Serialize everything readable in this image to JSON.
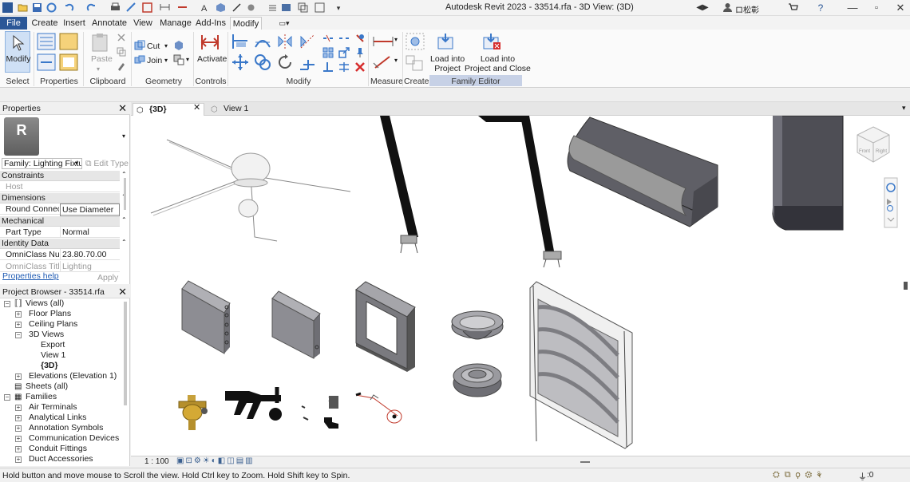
{
  "title": "Autodesk Revit 2023 - 33514.rfa - 3D View: (3D)",
  "user": "ロ松彰",
  "menu": [
    "File",
    "Create",
    "Insert",
    "Annotate",
    "View",
    "Manage",
    "Add-Ins",
    "Modify"
  ],
  "ribbon": {
    "modify_label": "Modify",
    "paste_label": "Paste",
    "cut_label": "Cut",
    "join_label": "Join",
    "activate_label": "Activate",
    "load_into_project": "Load into\nProject",
    "load_into_project_close": "Load into\nProject and Close",
    "panels": {
      "select": "Select",
      "properties": "Properties",
      "clipboard": "Clipboard",
      "geometry": "Geometry",
      "controls": "Controls",
      "modify": "Modify",
      "measure": "Measure",
      "create": "Create",
      "family_editor": "Family Editor"
    }
  },
  "properties": {
    "header": "Properties",
    "family_selector": "Family: Lighting Fixtur",
    "edit_type": "Edit Type",
    "groups": {
      "constraints": "Constraints",
      "dimensions": "Dimensions",
      "mechanical": "Mechanical",
      "identity": "Identity Data"
    },
    "rows": {
      "host": {
        "k": "Host",
        "v": ""
      },
      "round": {
        "k": "Round Connect...",
        "v": "Use Diameter"
      },
      "part": {
        "k": "Part Type",
        "v": "Normal"
      },
      "omni_num": {
        "k": "OmniClass Nu...",
        "v": "23.80.70.00"
      },
      "omni_title": {
        "k": "OmniClass Title",
        "v": "Lighting"
      }
    },
    "help_link": "Properties help",
    "apply": "Apply"
  },
  "browser": {
    "header": "Project Browser - 33514.rfa",
    "items": {
      "views": "Views (all)",
      "floor": "Floor Plans",
      "ceiling": "Ceiling Plans",
      "views3d": "3D Views",
      "export": "Export",
      "view1": "View 1",
      "v3d": "{3D}",
      "elev": "Elevations (Elevation 1)",
      "sheets": "Sheets (all)",
      "families": "Families",
      "air": "Air Terminals",
      "analytical": "Analytical Links",
      "annotation": "Annotation Symbols",
      "comm": "Communication Devices",
      "conduit": "Conduit Fittings",
      "duct": "Duct Accessories"
    }
  },
  "tabs": {
    "t3d": "{3D}",
    "view1": "View 1"
  },
  "viewbar": {
    "scale": "1 : 100"
  },
  "viewcube": {
    "front": "Front",
    "right": "Right"
  },
  "status": {
    "hint": "Hold button and move mouse to Scroll the view. Hold Ctrl key to Zoom. Hold Shift key to Spin.",
    "filter_count": ":0"
  },
  "colors": {
    "file_tab": "#2b5797",
    "family_editor_bar": "#c7d1e6",
    "ribbon_blue": "#3a78c9"
  }
}
